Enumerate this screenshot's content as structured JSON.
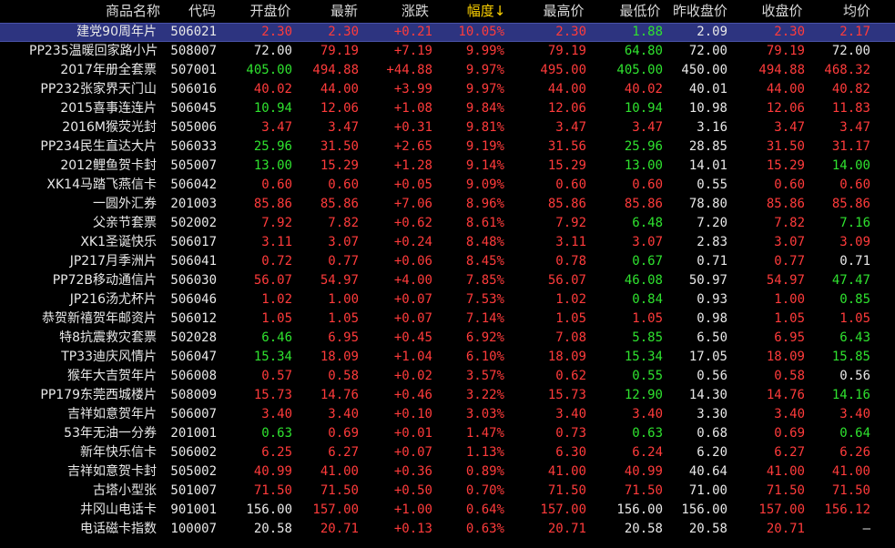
{
  "header": {
    "name": "商品名称",
    "code": "代码",
    "open": "开盘价",
    "latest": "最新",
    "change": "涨跌",
    "amplitude": "幅度↓",
    "high": "最高价",
    "low": "最低价",
    "prev_close": "昨收盘价",
    "close": "收盘价",
    "avg": "均价"
  },
  "colors": {
    "up": "#ff3b3b",
    "down": "#2fe22f",
    "flat": "#e8e8e8",
    "selected_row_bg": "#2d3480",
    "sort_header": "#ffd400"
  },
  "rows": [
    {
      "name": "建党90周年片",
      "code": "506021",
      "open": "2.30",
      "latest": "2.30",
      "change": "+0.21",
      "amplitude": "10.05%",
      "high": "2.30",
      "low": "1.88",
      "prev_close": "2.09",
      "close": "2.30",
      "avg": "2.17",
      "c": [
        "r",
        "r",
        "r",
        "r",
        "r",
        "g",
        "w",
        "r",
        "r"
      ]
    },
    {
      "name": "PP235温暖回家路小片",
      "code": "508007",
      "open": "72.00",
      "latest": "79.19",
      "change": "+7.19",
      "amplitude": "9.99%",
      "high": "79.19",
      "low": "64.80",
      "prev_close": "72.00",
      "close": "79.19",
      "avg": "72.00",
      "c": [
        "w",
        "r",
        "r",
        "r",
        "r",
        "g",
        "w",
        "r",
        "w"
      ]
    },
    {
      "name": "2017年册全套票",
      "code": "507001",
      "open": "405.00",
      "latest": "494.88",
      "change": "+44.88",
      "amplitude": "9.97%",
      "high": "495.00",
      "low": "405.00",
      "prev_close": "450.00",
      "close": "494.88",
      "avg": "468.32",
      "c": [
        "g",
        "r",
        "r",
        "r",
        "r",
        "g",
        "w",
        "r",
        "r"
      ]
    },
    {
      "name": "PP232张家界天门山",
      "code": "506016",
      "open": "40.02",
      "latest": "44.00",
      "change": "+3.99",
      "amplitude": "9.97%",
      "high": "44.00",
      "low": "40.02",
      "prev_close": "40.01",
      "close": "44.00",
      "avg": "40.82",
      "c": [
        "r",
        "r",
        "r",
        "r",
        "r",
        "r",
        "w",
        "r",
        "r"
      ]
    },
    {
      "name": "2015喜事连连片",
      "code": "506045",
      "open": "10.94",
      "latest": "12.06",
      "change": "+1.08",
      "amplitude": "9.84%",
      "high": "12.06",
      "low": "10.94",
      "prev_close": "10.98",
      "close": "12.06",
      "avg": "11.83",
      "c": [
        "g",
        "r",
        "r",
        "r",
        "r",
        "g",
        "w",
        "r",
        "r"
      ]
    },
    {
      "name": "2016M猴荧光封",
      "code": "505006",
      "open": "3.47",
      "latest": "3.47",
      "change": "+0.31",
      "amplitude": "9.81%",
      "high": "3.47",
      "low": "3.47",
      "prev_close": "3.16",
      "close": "3.47",
      "avg": "3.47",
      "c": [
        "r",
        "r",
        "r",
        "r",
        "r",
        "r",
        "w",
        "r",
        "r"
      ]
    },
    {
      "name": "PP234民生直达大片",
      "code": "506033",
      "open": "25.96",
      "latest": "31.50",
      "change": "+2.65",
      "amplitude": "9.19%",
      "high": "31.56",
      "low": "25.96",
      "prev_close": "28.85",
      "close": "31.50",
      "avg": "31.17",
      "c": [
        "g",
        "r",
        "r",
        "r",
        "r",
        "g",
        "w",
        "r",
        "r"
      ]
    },
    {
      "name": "2012鲤鱼贺卡封",
      "code": "505007",
      "open": "13.00",
      "latest": "15.29",
      "change": "+1.28",
      "amplitude": "9.14%",
      "high": "15.29",
      "low": "13.00",
      "prev_close": "14.01",
      "close": "15.29",
      "avg": "14.00",
      "c": [
        "g",
        "r",
        "r",
        "r",
        "r",
        "g",
        "w",
        "r",
        "g"
      ]
    },
    {
      "name": "XK14马踏飞燕信卡",
      "code": "506042",
      "open": "0.60",
      "latest": "0.60",
      "change": "+0.05",
      "amplitude": "9.09%",
      "high": "0.60",
      "low": "0.60",
      "prev_close": "0.55",
      "close": "0.60",
      "avg": "0.60",
      "c": [
        "r",
        "r",
        "r",
        "r",
        "r",
        "r",
        "w",
        "r",
        "r"
      ]
    },
    {
      "name": "一圆外汇券",
      "code": "201003",
      "open": "85.86",
      "latest": "85.86",
      "change": "+7.06",
      "amplitude": "8.96%",
      "high": "85.86",
      "low": "85.86",
      "prev_close": "78.80",
      "close": "85.86",
      "avg": "85.86",
      "c": [
        "r",
        "r",
        "r",
        "r",
        "r",
        "r",
        "w",
        "r",
        "r"
      ]
    },
    {
      "name": "父亲节套票",
      "code": "502002",
      "open": "7.92",
      "latest": "7.82",
      "change": "+0.62",
      "amplitude": "8.61%",
      "high": "7.92",
      "low": "6.48",
      "prev_close": "7.20",
      "close": "7.82",
      "avg": "7.16",
      "c": [
        "r",
        "r",
        "r",
        "r",
        "r",
        "g",
        "w",
        "r",
        "g"
      ]
    },
    {
      "name": "XK1圣诞快乐",
      "code": "506017",
      "open": "3.11",
      "latest": "3.07",
      "change": "+0.24",
      "amplitude": "8.48%",
      "high": "3.11",
      "low": "3.07",
      "prev_close": "2.83",
      "close": "3.07",
      "avg": "3.09",
      "c": [
        "r",
        "r",
        "r",
        "r",
        "r",
        "r",
        "w",
        "r",
        "r"
      ]
    },
    {
      "name": "JP217月季洲片",
      "code": "506041",
      "open": "0.72",
      "latest": "0.77",
      "change": "+0.06",
      "amplitude": "8.45%",
      "high": "0.78",
      "low": "0.67",
      "prev_close": "0.71",
      "close": "0.77",
      "avg": "0.71",
      "c": [
        "r",
        "r",
        "r",
        "r",
        "r",
        "g",
        "w",
        "r",
        "w"
      ]
    },
    {
      "name": "PP72B移动通信片",
      "code": "506030",
      "open": "56.07",
      "latest": "54.97",
      "change": "+4.00",
      "amplitude": "7.85%",
      "high": "56.07",
      "low": "46.08",
      "prev_close": "50.97",
      "close": "54.97",
      "avg": "47.47",
      "c": [
        "r",
        "r",
        "r",
        "r",
        "r",
        "g",
        "w",
        "r",
        "g"
      ]
    },
    {
      "name": "JP216汤尤杯片",
      "code": "506046",
      "open": "1.02",
      "latest": "1.00",
      "change": "+0.07",
      "amplitude": "7.53%",
      "high": "1.02",
      "low": "0.84",
      "prev_close": "0.93",
      "close": "1.00",
      "avg": "0.85",
      "c": [
        "r",
        "r",
        "r",
        "r",
        "r",
        "g",
        "w",
        "r",
        "g"
      ]
    },
    {
      "name": "恭贺新禧贺年邮资片",
      "code": "506012",
      "open": "1.05",
      "latest": "1.05",
      "change": "+0.07",
      "amplitude": "7.14%",
      "high": "1.05",
      "low": "1.05",
      "prev_close": "0.98",
      "close": "1.05",
      "avg": "1.05",
      "c": [
        "r",
        "r",
        "r",
        "r",
        "r",
        "r",
        "w",
        "r",
        "r"
      ]
    },
    {
      "name": "特8抗震救灾套票",
      "code": "502028",
      "open": "6.46",
      "latest": "6.95",
      "change": "+0.45",
      "amplitude": "6.92%",
      "high": "7.08",
      "low": "5.85",
      "prev_close": "6.50",
      "close": "6.95",
      "avg": "6.43",
      "c": [
        "g",
        "r",
        "r",
        "r",
        "r",
        "g",
        "w",
        "r",
        "g"
      ]
    },
    {
      "name": "TP33迪庆风情片",
      "code": "506047",
      "open": "15.34",
      "latest": "18.09",
      "change": "+1.04",
      "amplitude": "6.10%",
      "high": "18.09",
      "low": "15.34",
      "prev_close": "17.05",
      "close": "18.09",
      "avg": "15.85",
      "c": [
        "g",
        "r",
        "r",
        "r",
        "r",
        "g",
        "w",
        "r",
        "g"
      ]
    },
    {
      "name": "猴年大吉贺年片",
      "code": "506008",
      "open": "0.57",
      "latest": "0.58",
      "change": "+0.02",
      "amplitude": "3.57%",
      "high": "0.62",
      "low": "0.55",
      "prev_close": "0.56",
      "close": "0.58",
      "avg": "0.56",
      "c": [
        "r",
        "r",
        "r",
        "r",
        "r",
        "g",
        "w",
        "r",
        "w"
      ]
    },
    {
      "name": "PP179东莞西城楼片",
      "code": "508009",
      "open": "15.73",
      "latest": "14.76",
      "change": "+0.46",
      "amplitude": "3.22%",
      "high": "15.73",
      "low": "12.90",
      "prev_close": "14.30",
      "close": "14.76",
      "avg": "14.16",
      "c": [
        "r",
        "r",
        "r",
        "r",
        "r",
        "g",
        "w",
        "r",
        "g"
      ]
    },
    {
      "name": "吉祥如意贺年片",
      "code": "506007",
      "open": "3.40",
      "latest": "3.40",
      "change": "+0.10",
      "amplitude": "3.03%",
      "high": "3.40",
      "low": "3.40",
      "prev_close": "3.30",
      "close": "3.40",
      "avg": "3.40",
      "c": [
        "r",
        "r",
        "r",
        "r",
        "r",
        "r",
        "w",
        "r",
        "r"
      ]
    },
    {
      "name": "53年无油一分券",
      "code": "201001",
      "open": "0.63",
      "latest": "0.69",
      "change": "+0.01",
      "amplitude": "1.47%",
      "high": "0.73",
      "low": "0.63",
      "prev_close": "0.68",
      "close": "0.69",
      "avg": "0.64",
      "c": [
        "g",
        "r",
        "r",
        "r",
        "r",
        "g",
        "w",
        "r",
        "g"
      ]
    },
    {
      "name": "新年快乐信卡",
      "code": "506002",
      "open": "6.25",
      "latest": "6.27",
      "change": "+0.07",
      "amplitude": "1.13%",
      "high": "6.30",
      "low": "6.24",
      "prev_close": "6.20",
      "close": "6.27",
      "avg": "6.26",
      "c": [
        "r",
        "r",
        "r",
        "r",
        "r",
        "r",
        "w",
        "r",
        "r"
      ]
    },
    {
      "name": "吉祥如意贺卡封",
      "code": "505002",
      "open": "40.99",
      "latest": "41.00",
      "change": "+0.36",
      "amplitude": "0.89%",
      "high": "41.00",
      "low": "40.99",
      "prev_close": "40.64",
      "close": "41.00",
      "avg": "41.00",
      "c": [
        "r",
        "r",
        "r",
        "r",
        "r",
        "r",
        "w",
        "r",
        "r"
      ]
    },
    {
      "name": "古塔小型张",
      "code": "501007",
      "open": "71.50",
      "latest": "71.50",
      "change": "+0.50",
      "amplitude": "0.70%",
      "high": "71.50",
      "low": "71.50",
      "prev_close": "71.00",
      "close": "71.50",
      "avg": "71.50",
      "c": [
        "r",
        "r",
        "r",
        "r",
        "r",
        "r",
        "w",
        "r",
        "r"
      ]
    },
    {
      "name": "井冈山电话卡",
      "code": "901001",
      "open": "156.00",
      "latest": "157.00",
      "change": "+1.00",
      "amplitude": "0.64%",
      "high": "157.00",
      "low": "156.00",
      "prev_close": "156.00",
      "close": "157.00",
      "avg": "156.12",
      "c": [
        "w",
        "r",
        "r",
        "r",
        "r",
        "w",
        "w",
        "r",
        "r"
      ]
    },
    {
      "name": "电话磁卡指数",
      "code": "100007",
      "open": "20.58",
      "latest": "20.71",
      "change": "+0.13",
      "amplitude": "0.63%",
      "high": "20.71",
      "low": "20.58",
      "prev_close": "20.58",
      "close": "20.71",
      "avg": "—",
      "c": [
        "w",
        "r",
        "r",
        "r",
        "r",
        "w",
        "w",
        "r",
        "w"
      ]
    }
  ]
}
